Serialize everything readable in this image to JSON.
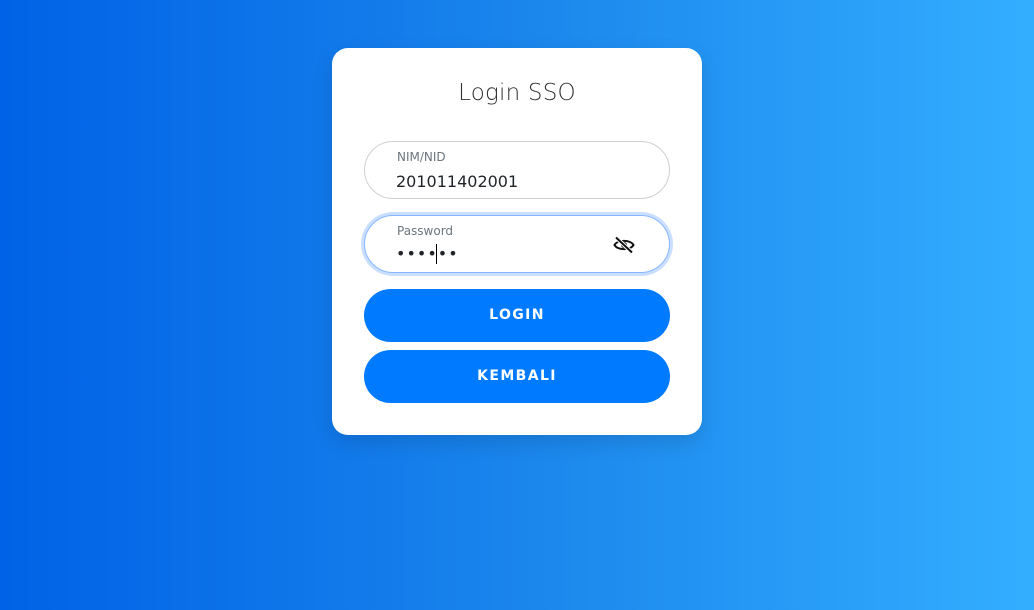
{
  "card": {
    "title": "Login SSO"
  },
  "form": {
    "nim": {
      "label": "NIM/NID",
      "value": "201011402001"
    },
    "password": {
      "label": "Password",
      "masked_value": "••••••",
      "toggle_icon": "eye-slash-icon"
    }
  },
  "buttons": {
    "login_label": "LOGIN",
    "back_label": "KEMBALI"
  },
  "colors": {
    "background_start": "#0062e6",
    "background_end": "#33aeff",
    "button": "#007bff",
    "focus_ring": "#86b7fe"
  }
}
